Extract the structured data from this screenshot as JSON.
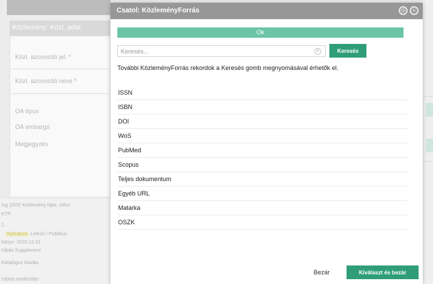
{
  "background": {
    "panel_title": "Közlemény: Közl. adat",
    "fields": [
      "Közl. azonosító jel. *",
      "Közl. azonosító neve *",
      "OA típus",
      "OA embargó",
      "Megjegyzés"
    ],
    "bottom_lines": [
      "ing (DOI) Közlemény fajta, stílus",
      "KTP",
      "1.",
      "Nyilvános",
      "Létező / Publikus",
      "könyv: 2020.12.31",
      "Hibás Supplement",
      "Katalógus Kiadás",
      "Utolsó módosítás"
    ]
  },
  "modal": {
    "title": "Csatol: KözleményForrás",
    "ok_label": "Ok",
    "search": {
      "placeholder": "Keresés...",
      "button_label": "Keresés"
    },
    "info_text": "További KözleményForrás rekordok a Keresés gomb megnyomásával érhetők el.",
    "items": [
      "ISSN",
      "ISBN",
      "DOI",
      "WoS",
      "PubMed",
      "Scopus",
      "Teljes dokumentum",
      "Egyéb URL",
      "Matarka",
      "OSZK"
    ],
    "footer": {
      "close_label": "Bezár",
      "select_close_label": "Kiválaszt és bezár"
    }
  },
  "colors": {
    "header_bg": "#979797",
    "ok_bar": "#6bc4a6",
    "primary_button": "#2f9e78"
  },
  "icons": {
    "header_icons": [
      "settings-icon",
      "close-icon"
    ],
    "search_clear": "clear-icon"
  }
}
